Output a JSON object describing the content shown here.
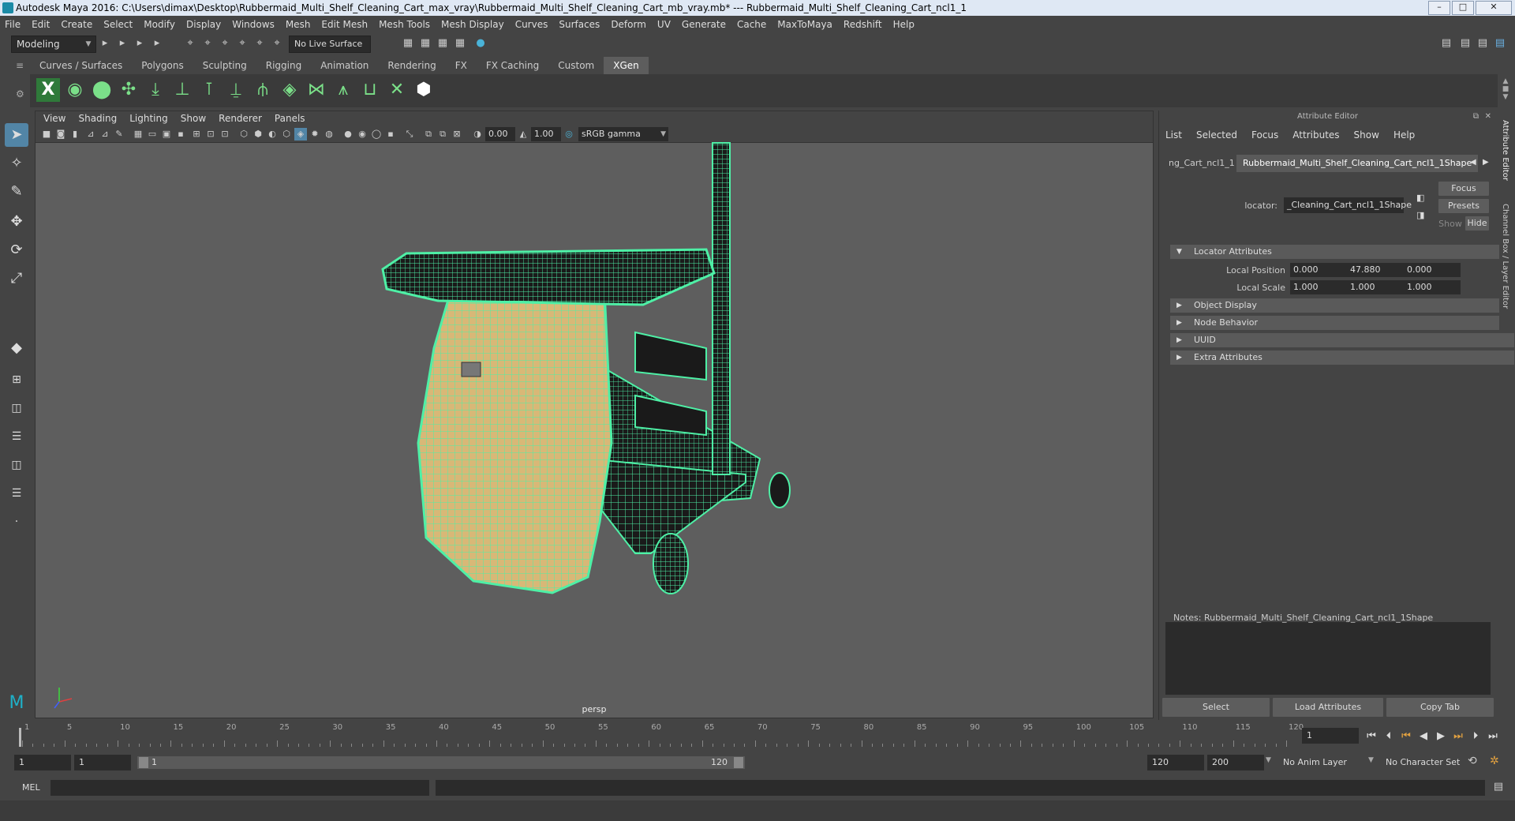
{
  "window": {
    "title": "Autodesk Maya 2016: C:\\Users\\dimax\\Desktop\\Rubbermaid_Multi_Shelf_Cleaning_Cart_max_vray\\Rubbermaid_Multi_Shelf_Cleaning_Cart_mb_vray.mb*   ---   Rubbermaid_Multi_Shelf_Cleaning_Cart_ncl1_1",
    "minimize": "–",
    "maximize": "□",
    "close": "✕"
  },
  "menubar": [
    "File",
    "Edit",
    "Create",
    "Select",
    "Modify",
    "Display",
    "Windows",
    "Mesh",
    "Edit Mesh",
    "Mesh Tools",
    "Mesh Display",
    "Curves",
    "Surfaces",
    "Deform",
    "UV",
    "Generate",
    "Cache",
    "MaxToMaya",
    "Redshift",
    "Help"
  ],
  "statusline": {
    "mode": "Modeling",
    "live_surface": "No Live Surface"
  },
  "shelf_tabs": [
    "Curves / Surfaces",
    "Polygons",
    "Sculpting",
    "Rigging",
    "Animation",
    "Rendering",
    "FX",
    "FX Caching",
    "Custom",
    "XGen"
  ],
  "shelf_active": "XGen",
  "viewport": {
    "menu": [
      "View",
      "Shading",
      "Lighting",
      "Show",
      "Renderer",
      "Panels"
    ],
    "exposure": "0.00",
    "gamma": "1.00",
    "color_space": "sRGB gamma",
    "camera_label": "persp"
  },
  "attribute_editor": {
    "title": "Attribute Editor",
    "menu": [
      "List",
      "Selected",
      "Focus",
      "Attributes",
      "Show",
      "Help"
    ],
    "tab_prev": "ng_Cart_ncl1_1",
    "tab_active": "Rubbermaid_Multi_Shelf_Cleaning_Cart_ncl1_1Shape",
    "node_type_label": "locator:",
    "node_name": "_Cleaning_Cart_ncl1_1Shape",
    "focus_btn": "Focus",
    "presets_btn": "Presets",
    "show_btn": "Show",
    "hide_btn": "Hide",
    "sections": {
      "locator": "Locator Attributes",
      "object_display": "Object Display",
      "node_behavior": "Node Behavior",
      "uuid": "UUID",
      "extra": "Extra Attributes"
    },
    "local_position_label": "Local Position",
    "local_position": [
      "0.000",
      "47.880",
      "0.000"
    ],
    "local_scale_label": "Local Scale",
    "local_scale": [
      "1.000",
      "1.000",
      "1.000"
    ],
    "notes_label": "Notes:  Rubbermaid_Multi_Shelf_Cleaning_Cart_ncl1_1Shape",
    "buttons": [
      "Select",
      "Load Attributes",
      "Copy Tab"
    ]
  },
  "side_tabs": [
    "Attribute Editor",
    "Channel Box / Layer Editor"
  ],
  "timeline": {
    "ticks": [
      "1",
      "5",
      "10",
      "15",
      "20",
      "25",
      "30",
      "35",
      "40",
      "45",
      "50",
      "55",
      "60",
      "65",
      "70",
      "75",
      "80",
      "85",
      "90",
      "95",
      "100",
      "105",
      "110",
      "115",
      "120"
    ],
    "current_frame": "1"
  },
  "range": {
    "start": "1",
    "playback_start": "1",
    "range_start_label": "1",
    "range_end_label": "120",
    "playback_end": "120",
    "end": "200",
    "anim_layer": "No Anim Layer",
    "character_set": "No Character Set"
  },
  "commandline": {
    "label": "MEL"
  },
  "colors": {
    "wire": "#4ef0a6",
    "surface": "#d8b877",
    "accent": "#5285a6"
  }
}
